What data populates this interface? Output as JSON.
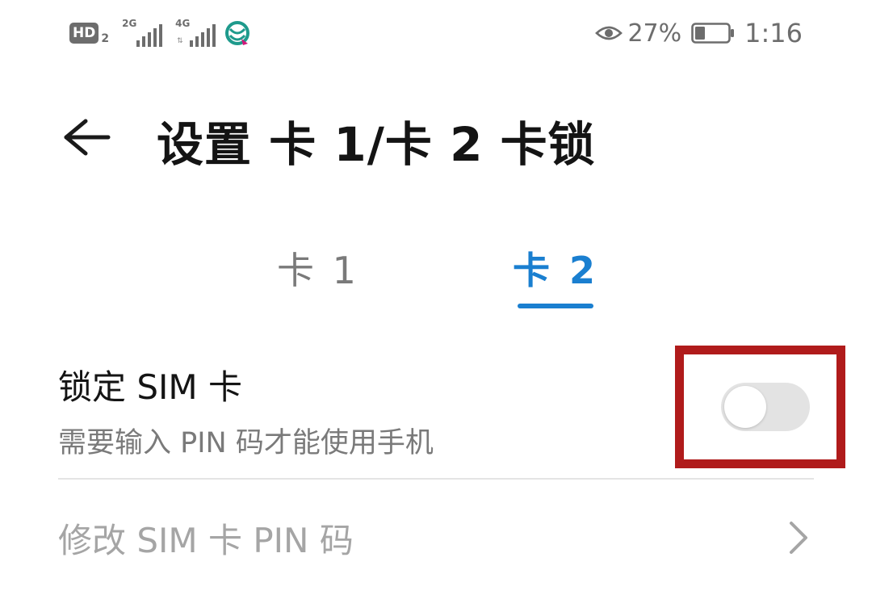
{
  "status_bar": {
    "hd_label": "HD",
    "hd_sub": "2",
    "network_1": "2G",
    "network_2": "4G",
    "battery_percent": "27%",
    "time": "1:16"
  },
  "header": {
    "title": "设置 卡 1/卡 2 卡锁"
  },
  "tabs": [
    {
      "label": "卡 1",
      "selected": false
    },
    {
      "label": "卡 2",
      "selected": true
    }
  ],
  "settings": {
    "lock_sim": {
      "title": "锁定 SIM 卡",
      "description": "需要输入 PIN 码才能使用手机",
      "enabled": false
    },
    "change_pin": {
      "label": "修改 SIM 卡 PIN 码",
      "enabled": false
    }
  },
  "colors": {
    "accent": "#1a7fd0",
    "highlight": "#b01b1b",
    "toggle_off": "#e3e3e3"
  }
}
